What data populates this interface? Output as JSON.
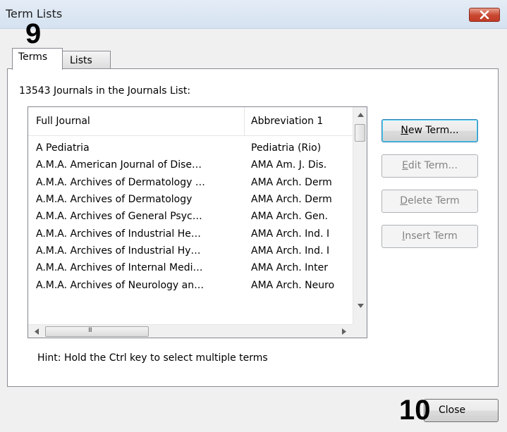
{
  "window": {
    "title": "Term Lists",
    "close_icon": "close-x-icon",
    "close_button_color": "#c84630"
  },
  "annotations": {
    "badge_a": "9",
    "badge_b": "10"
  },
  "tabs": [
    {
      "label": "Terms",
      "selected": true
    },
    {
      "label": "Lists",
      "selected": false
    }
  ],
  "list": {
    "count_label": "13543 Journals in the Journals List:",
    "columns": [
      "Full Journal",
      "Abbreviation 1"
    ],
    "rows": [
      [
        "A Pediatria",
        "Pediatria (Rio)"
      ],
      [
        "A.M.A. American Journal of Dise…",
        "AMA Am. J. Dis."
      ],
      [
        "A.M.A. Archives of Dermatology …",
        "AMA Arch. Derm"
      ],
      [
        "A.M.A. Archives of Dermatology",
        "AMA Arch. Derm"
      ],
      [
        "A.M.A. Archives of General Psyc…",
        "AMA Arch. Gen."
      ],
      [
        "A.M.A. Archives of Industrial He…",
        "AMA Arch. Ind. I"
      ],
      [
        "A.M.A. Archives of Industrial Hy…",
        "AMA Arch. Ind. I"
      ],
      [
        "A.M.A. Archives of Internal Medi…",
        "AMA Arch. Inter"
      ],
      [
        "A.M.A. Archives of Neurology an…",
        "AMA Arch. Neuro"
      ]
    ],
    "hscroll_grip": "III"
  },
  "buttons": {
    "new_term": {
      "accel": "N",
      "rest": "ew Term..."
    },
    "edit_term": {
      "accel": "E",
      "rest": "dit Term..."
    },
    "delete_term": {
      "accel": "D",
      "rest": "elete Term"
    },
    "insert_term": {
      "accel": "I",
      "rest": "nsert Term"
    },
    "close": "Close"
  },
  "hint": "Hint: Hold the Ctrl key to select multiple terms"
}
